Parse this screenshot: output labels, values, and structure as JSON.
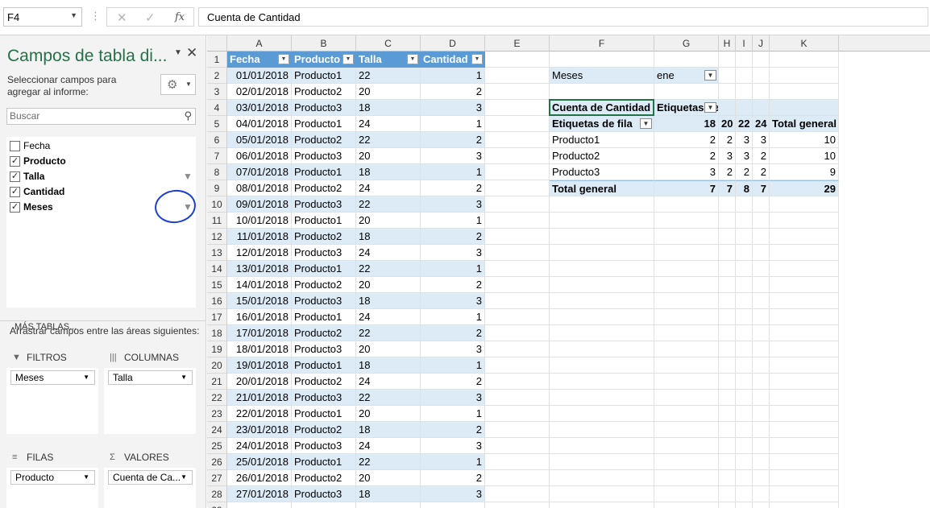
{
  "formula_bar": {
    "name_box": "F4",
    "separator": "⋮",
    "cancel_icon": "✕",
    "enter_icon": "✓",
    "fx_label": "fx",
    "formula": "Cuenta de Cantidad"
  },
  "pane": {
    "title": "Campos de tabla di...",
    "instructions": "Seleccionar campos para agregar al informe:",
    "search_placeholder": "Buscar",
    "fields": [
      {
        "label": "Fecha",
        "checked": false,
        "filter": false
      },
      {
        "label": "Producto",
        "checked": true,
        "filter": false
      },
      {
        "label": "Talla",
        "checked": true,
        "filter": true
      },
      {
        "label": "Cantidad",
        "checked": true,
        "filter": false
      },
      {
        "label": "Meses",
        "checked": true,
        "filter": true
      }
    ],
    "more_tables": "MÁS TABLAS...",
    "areas_instructions": "Arrastrar campos entre las áreas siguientes:",
    "areas": {
      "filters": {
        "title": "FILTROS",
        "chip": "Meses"
      },
      "columns": {
        "title": "COLUMNAS",
        "chip": "Talla"
      },
      "rows": {
        "title": "FILAS",
        "chip": "Producto"
      },
      "values": {
        "title": "VALORES",
        "chip": "Cuenta de Ca..."
      }
    },
    "annotation_color": "#1d3fcf"
  },
  "grid": {
    "columns": [
      "A",
      "B",
      "C",
      "D",
      "E",
      "F",
      "G",
      "H",
      "I",
      "J",
      "K"
    ],
    "table_headers": [
      "Fecha",
      "Producto",
      "Talla",
      "Cantidad"
    ],
    "rows": [
      [
        "01/01/2018",
        "Producto1",
        "22",
        "1"
      ],
      [
        "02/01/2018",
        "Producto2",
        "20",
        "2"
      ],
      [
        "03/01/2018",
        "Producto3",
        "18",
        "3"
      ],
      [
        "04/01/2018",
        "Producto1",
        "24",
        "1"
      ],
      [
        "05/01/2018",
        "Producto2",
        "22",
        "2"
      ],
      [
        "06/01/2018",
        "Producto3",
        "20",
        "3"
      ],
      [
        "07/01/2018",
        "Producto1",
        "18",
        "1"
      ],
      [
        "08/01/2018",
        "Producto2",
        "24",
        "2"
      ],
      [
        "09/01/2018",
        "Producto3",
        "22",
        "3"
      ],
      [
        "10/01/2018",
        "Producto1",
        "20",
        "1"
      ],
      [
        "11/01/2018",
        "Producto2",
        "18",
        "2"
      ],
      [
        "12/01/2018",
        "Producto3",
        "24",
        "3"
      ],
      [
        "13/01/2018",
        "Producto1",
        "22",
        "1"
      ],
      [
        "14/01/2018",
        "Producto2",
        "20",
        "2"
      ],
      [
        "15/01/2018",
        "Producto3",
        "18",
        "3"
      ],
      [
        "16/01/2018",
        "Producto1",
        "24",
        "1"
      ],
      [
        "17/01/2018",
        "Producto2",
        "22",
        "2"
      ],
      [
        "18/01/2018",
        "Producto3",
        "20",
        "3"
      ],
      [
        "19/01/2018",
        "Producto1",
        "18",
        "1"
      ],
      [
        "20/01/2018",
        "Producto2",
        "24",
        "2"
      ],
      [
        "21/01/2018",
        "Producto3",
        "22",
        "3"
      ],
      [
        "22/01/2018",
        "Producto1",
        "20",
        "1"
      ],
      [
        "23/01/2018",
        "Producto2",
        "18",
        "2"
      ],
      [
        "24/01/2018",
        "Producto3",
        "24",
        "3"
      ],
      [
        "25/01/2018",
        "Producto1",
        "22",
        "1"
      ],
      [
        "26/01/2018",
        "Producto2",
        "20",
        "2"
      ],
      [
        "27/01/2018",
        "Producto3",
        "18",
        "3"
      ]
    ]
  },
  "pivot": {
    "filter_label": "Meses",
    "filter_value": "ene",
    "values_label": "Cuenta de Cantidad",
    "column_labels": "Etiquetas de columna",
    "row_labels": "Etiquetas de fila",
    "sizes": [
      "18",
      "20",
      "22",
      "24"
    ],
    "grand_total_label": "Total general",
    "body": [
      {
        "label": "Producto1",
        "values": [
          "2",
          "2",
          "3",
          "3"
        ],
        "total": "10"
      },
      {
        "label": "Producto2",
        "values": [
          "2",
          "3",
          "3",
          "2"
        ],
        "total": "10"
      },
      {
        "label": "Producto3",
        "values": [
          "3",
          "2",
          "2",
          "2"
        ],
        "total": "9"
      }
    ],
    "totals": {
      "label": "Total general",
      "values": [
        "7",
        "7",
        "8",
        "7"
      ],
      "total": "29"
    }
  },
  "colors": {
    "accent": "#217346",
    "table_header": "#5b9bd5",
    "band": "#ddebf7"
  }
}
